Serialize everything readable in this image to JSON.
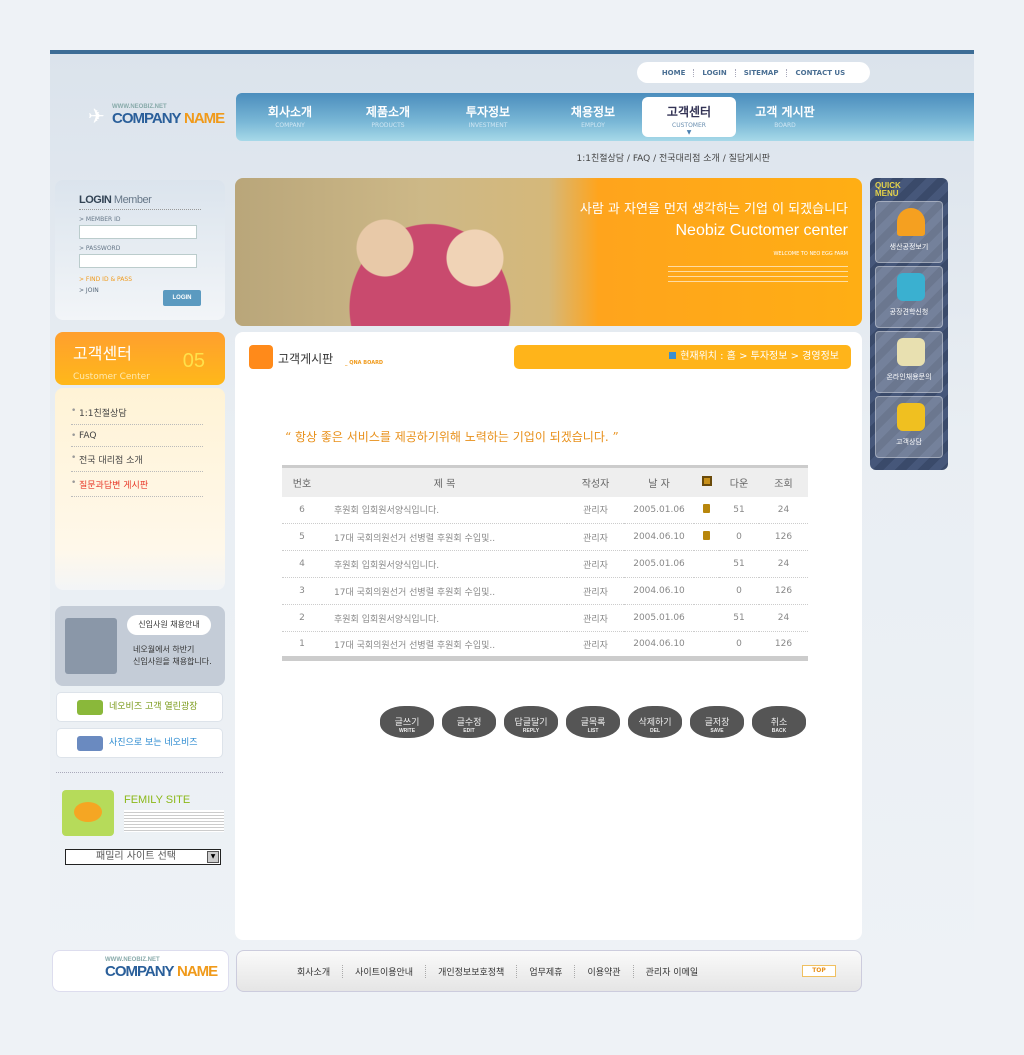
{
  "top_links": [
    "HOME",
    "LOGIN",
    "SITEMAP",
    "CONTACT US"
  ],
  "logo": {
    "url": "WWW.NEOBIZ.NET",
    "company": "COMPANY",
    "name": "NAME"
  },
  "nav": [
    {
      "ko": "회사소개",
      "en": "COMPANY"
    },
    {
      "ko": "제품소개",
      "en": "PRODUCTS"
    },
    {
      "ko": "투자정보",
      "en": "INVESTMENT"
    },
    {
      "ko": "채용정보",
      "en": "EMPLOY"
    },
    {
      "ko": "고객센터",
      "en": "CUSTOMER",
      "active": true
    },
    {
      "ko": "고객 게시판",
      "en": "BOARD"
    }
  ],
  "sub_nav": "1:1친절상담 / FAQ / 전국대리점 소개 / 질답게시판",
  "login": {
    "title_bold": "LOGIN",
    "title_rest": " Member",
    "member_id_label": "> MEMBER ID",
    "password_label": "> PASSWORD",
    "find": "> FIND ID & PASS",
    "join": "> JOIN",
    "button": "LOGIN"
  },
  "customer_center": {
    "title": "고객센터",
    "subtitle": "Customer Center",
    "number": "05"
  },
  "side_menu": [
    {
      "label": "1:1친절상담"
    },
    {
      "label": "FAQ"
    },
    {
      "label": "전국 대리점 소개"
    },
    {
      "label": "질문과답변 게시판",
      "current": true
    }
  ],
  "recruit": {
    "bubble": "신입사원 채용안내",
    "text1": "네오월에서 하반기",
    "text2": "신입사원을 채용합니다."
  },
  "banners": [
    "네오비즈 고객 열린광장",
    "사진으로 보는 네오비즈"
  ],
  "family": {
    "title": "FEMILY SITE",
    "select": "패밀리 사이트 선택"
  },
  "hero": {
    "slogan": "사람 과 자연을 먼저 생각하는 기업 이 되겠습니다",
    "title": "Neobiz Cuctomer center",
    "welcome": "WELCOME TO NEO EGG FARM"
  },
  "quick": {
    "title1": "QUICK",
    "title2": "MENU",
    "items": [
      "생산공정보기",
      "공장견학신청",
      "온라인채용문의",
      "고객상담"
    ]
  },
  "board": {
    "title": "고객게시판",
    "subtitle": "_ QNA BOARD",
    "location": "현재위치 : 홈 > 투자정보 > 경영정보",
    "quote": "“ 항상 좋은 서비스를 제공하기위해 노력하는 기업이 되겠습니다. ”",
    "columns": [
      "번호",
      "제 목",
      "작성자",
      "날 자",
      "",
      "다운",
      "조회"
    ],
    "rows": [
      {
        "no": "6",
        "title": "후원회 입회원서양식입니다.",
        "author": "관리자",
        "date": "2005.01.06",
        "file": true,
        "down": "51",
        "views": "24"
      },
      {
        "no": "5",
        "title": "17대 국회의원선거 선병렬 후원회 수입및..",
        "author": "관리자",
        "date": "2004.06.10",
        "file": true,
        "down": "0",
        "views": "126"
      },
      {
        "no": "4",
        "title": "후원회 입회원서양식입니다.",
        "author": "관리자",
        "date": "2005.01.06",
        "file": false,
        "down": "51",
        "views": "24"
      },
      {
        "no": "3",
        "title": "17대 국회의원선거 선병렬 후원회 수입및..",
        "author": "관리자",
        "date": "2004.06.10",
        "file": false,
        "down": "0",
        "views": "126"
      },
      {
        "no": "2",
        "title": "후원회 입회원서양식입니다.",
        "author": "관리자",
        "date": "2005.01.06",
        "file": false,
        "down": "51",
        "views": "24"
      },
      {
        "no": "1",
        "title": "17대 국회의원선거 선병렬 후원회 수입및..",
        "author": "관리자",
        "date": "2004.06.10",
        "file": false,
        "down": "0",
        "views": "126"
      }
    ],
    "buttons": [
      {
        "ko": "글쓰기",
        "en": "WRITE"
      },
      {
        "ko": "글수정",
        "en": "EDIT"
      },
      {
        "ko": "답글달기",
        "en": "REPLY"
      },
      {
        "ko": "글목록",
        "en": "LIST"
      },
      {
        "ko": "삭제하기",
        "en": "DEL"
      },
      {
        "ko": "글저장",
        "en": "SAVE"
      },
      {
        "ko": "취소",
        "en": "BACK"
      }
    ]
  },
  "footer": {
    "links": [
      "회사소개",
      "사이트이용안내",
      "개인정보보호정책",
      "업무제휴",
      "이용약관",
      "관리자 이메일"
    ],
    "top": "TOP"
  },
  "colors": {
    "accent": "#ffa41c",
    "nav": "#4b8dbd"
  }
}
